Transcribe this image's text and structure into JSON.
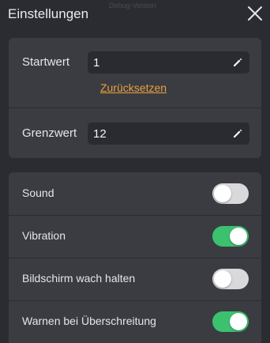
{
  "header": {
    "title": "Einstellungen",
    "watermark": "Debug-Version",
    "close_icon": "close-icon"
  },
  "values": {
    "start_label": "Startwert",
    "start_value": "1",
    "reset_label": "Zurücksetzen",
    "limit_label": "Grenzwert",
    "limit_value": "12",
    "edit_icon": "pencil-icon"
  },
  "toggles": [
    {
      "label": "Sound",
      "on": false
    },
    {
      "label": "Vibration",
      "on": true
    },
    {
      "label": "Bildschirm wach halten",
      "on": false
    },
    {
      "label": "Warnen bei Überschreitung",
      "on": true
    }
  ],
  "colors": {
    "background": "#2b2c31",
    "card": "#3b3c42",
    "accent_link": "#e9a13b",
    "toggle_on": "#3cc16f",
    "toggle_off": "#d9d9dc"
  }
}
